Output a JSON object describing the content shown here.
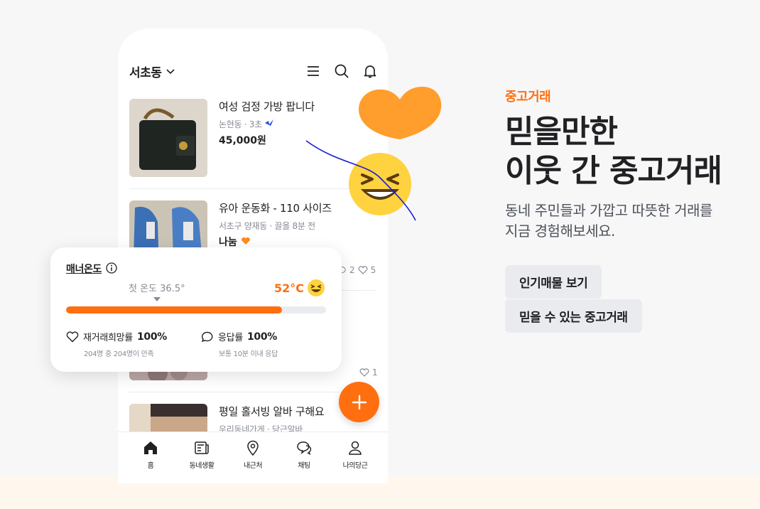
{
  "phone": {
    "location": "서초동",
    "icons": [
      "chevron-down-icon",
      "menu-icon",
      "search-icon",
      "bell-icon"
    ],
    "items": [
      {
        "title": "여성 검정 가방 팝니다",
        "meta": "논현동 · 3초",
        "price": "45,000원"
      },
      {
        "title": "유아 운동화 - 110 사이즈",
        "meta": "서초구 양재동 · 끌올 8분 전",
        "price": "나눔",
        "comments": "2",
        "likes": "5"
      },
      {
        "title": "",
        "meta": "",
        "price": "",
        "likes": "1"
      },
      {
        "title": "평일 홀서빙 알바 구해요",
        "meta": "우리동네가게 · 당근알바",
        "price": ""
      }
    ],
    "tabs": [
      {
        "label": "홈",
        "icon": "home-icon"
      },
      {
        "label": "동네생활",
        "icon": "newspaper-icon"
      },
      {
        "label": "내근처",
        "icon": "map-pin-icon"
      },
      {
        "label": "채팅",
        "icon": "chat-icon"
      },
      {
        "label": "나의당근",
        "icon": "user-icon"
      }
    ]
  },
  "manner": {
    "title": "매너온도",
    "first_temp": "첫 온도 36.5°",
    "temp": "52°C",
    "temp_fraction": 0.83,
    "rehire_label": "재거래희망률",
    "rehire_value": "100%",
    "rehire_sub": "204명 중 204명이 만족",
    "response_label": "응답률",
    "response_value": "100%",
    "response_sub": "보통 10분 이내 응답"
  },
  "hero": {
    "eyebrow": "중고거래",
    "headline_line1": "믿을만한",
    "headline_line2": "이웃 간 중고거래",
    "desc_line1": "동네 주민들과 가깝고 따뜻한 거래를",
    "desc_line2": "지금 경험해보세요.",
    "button1": "인기매물 보기",
    "button2": "믿을 수 있는 중고거래"
  },
  "colors": {
    "accent": "#ff6f0f",
    "heart": "#ff9e2c",
    "pill_bg": "#eaebee"
  }
}
